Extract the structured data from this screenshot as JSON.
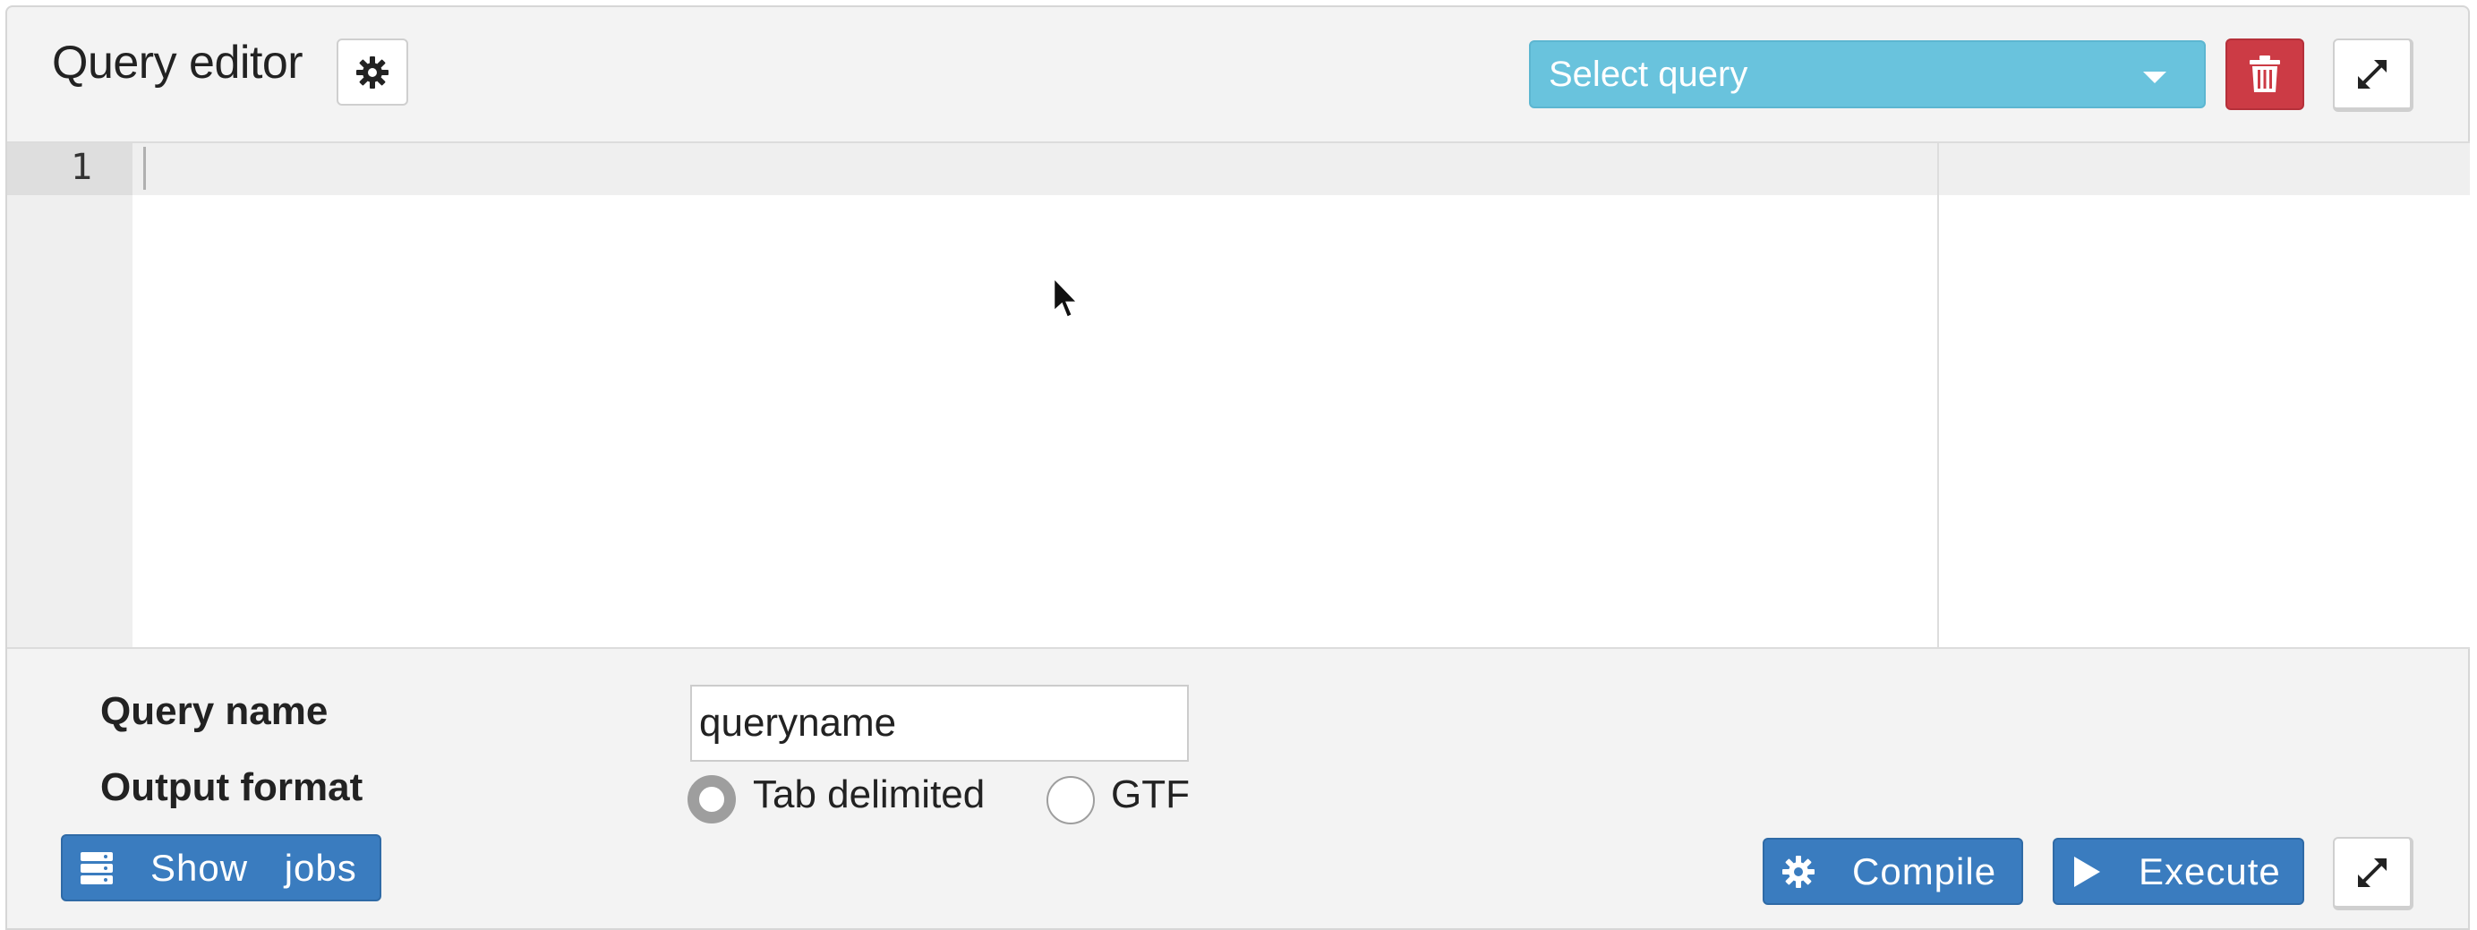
{
  "header": {
    "title": "Query editor",
    "settings_icon": "gear-icon",
    "select_query": {
      "placeholder": "Select query",
      "icon": "caret-down-icon"
    },
    "delete_icon": "trash-icon",
    "expand_icon": "expand-arrows-icon"
  },
  "editor": {
    "line_numbers": [
      "1"
    ],
    "content": ""
  },
  "form": {
    "query_name_label": "Query name",
    "query_name_value": "queryname",
    "output_format_label": "Output format",
    "output_options": [
      "Tab delimited",
      "GTF"
    ],
    "selected_output": "Tab delimited"
  },
  "footer": {
    "show_jobs_label": "Show jobs",
    "show_jobs_icon": "server-stack-icon",
    "compile_label": "Compile",
    "compile_icon": "gear-icon",
    "execute_label": "Execute",
    "execute_icon": "play-icon",
    "expand_icon": "expand-arrows-icon"
  },
  "colors": {
    "select_bg": "#69c3dd",
    "delete_bg": "#cc3b45",
    "primary_btn_bg": "#3a7cbf",
    "panel_bg": "#f3f3f3"
  }
}
